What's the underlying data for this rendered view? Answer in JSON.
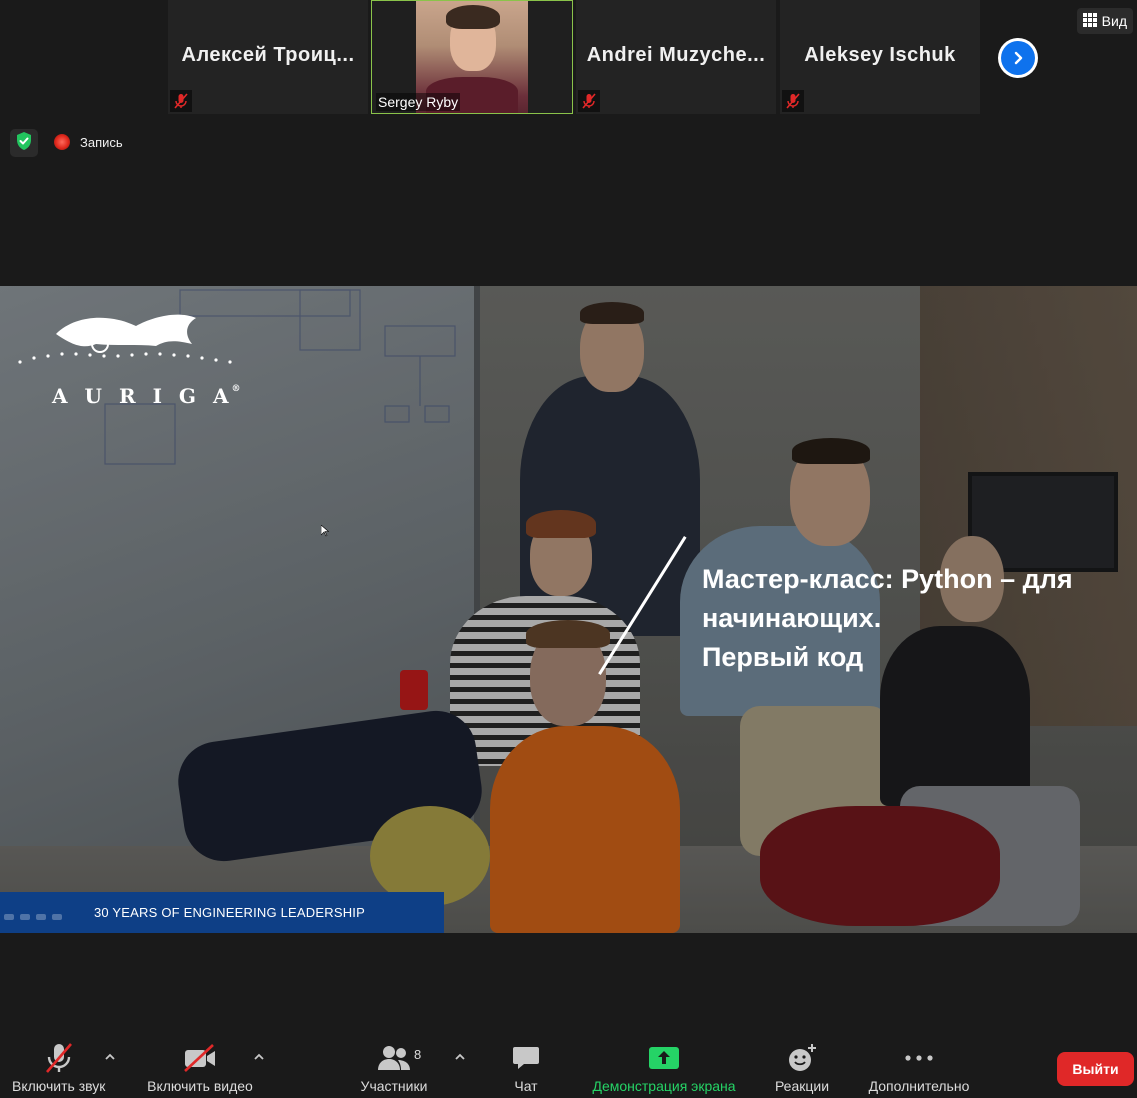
{
  "participants": [
    {
      "name": "Алексей  Троиц...",
      "muted": true
    },
    {
      "name": "Sergey Ryby",
      "video": true,
      "active_speaker": true
    },
    {
      "name": "Andrei  Muzyche...",
      "muted": true
    },
    {
      "name": "Aleksey Ischuk",
      "muted": true
    }
  ],
  "view_button": {
    "label": "Вид",
    "icon": "grid-icon"
  },
  "next_page_icon": "chevron-right-icon",
  "security_icon": "shield-check-icon",
  "recording": {
    "label": "Запись",
    "color": "#e0281c"
  },
  "slide": {
    "logo_text": "AURIGA",
    "logo_mark": "®",
    "title": "Мастер-класс: Python – для начинающих. Первый код",
    "title_lines": [
      "Мастер-класс: Python – для",
      "начинающих.",
      "Первый код"
    ],
    "banner": "30 YEARS OF ENGINEERING LEADERSHIP",
    "banner_color": "#0e3f86"
  },
  "toolbar": {
    "audio": {
      "label": "Включить звук",
      "icon": "mic-muted-icon"
    },
    "video": {
      "label": "Включить видео",
      "icon": "camera-off-icon"
    },
    "participants": {
      "label": "Участники",
      "count": "8",
      "icon": "people-icon"
    },
    "chat": {
      "label": "Чат",
      "icon": "chat-bubble-icon"
    },
    "share": {
      "label": "Демонстрация экрана",
      "icon": "share-screen-icon",
      "color": "#25d366"
    },
    "reactions": {
      "label": "Реакции",
      "icon": "emoji-plus-icon"
    },
    "more": {
      "label": "Дополнительно",
      "icon": "more-dots-icon"
    },
    "leave": {
      "label": "Выйти",
      "color": "#e02828"
    }
  }
}
